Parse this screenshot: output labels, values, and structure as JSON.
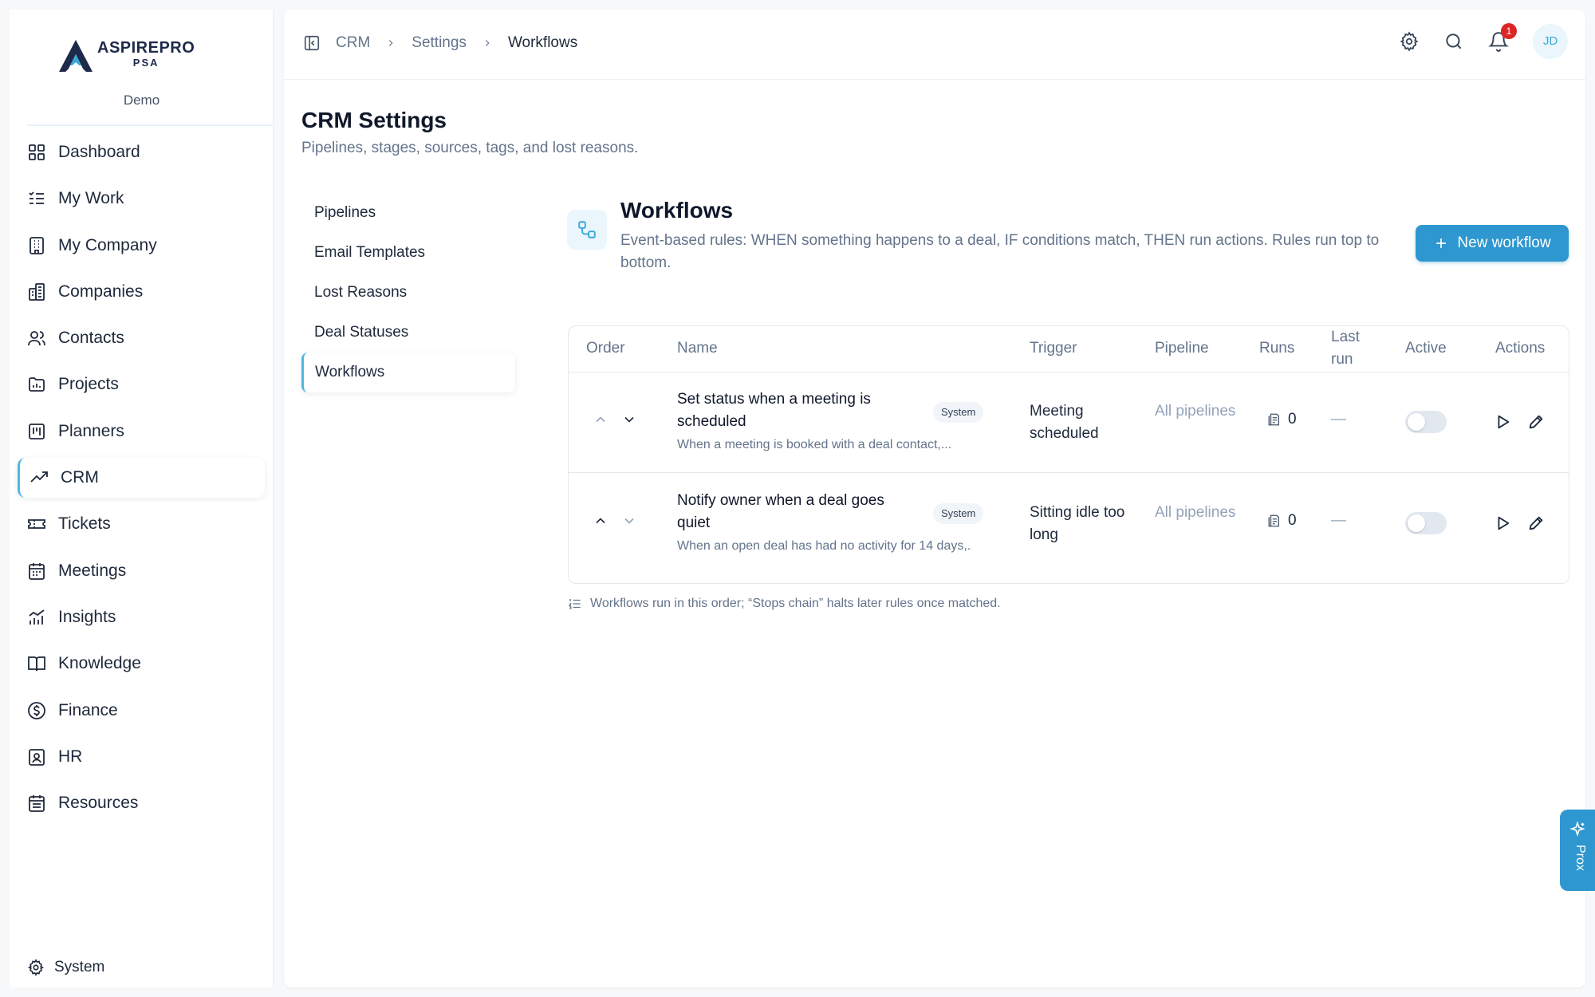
{
  "brand": {
    "name": "ASPIREPRO",
    "sub": "PSA",
    "org": "Demo"
  },
  "sidebar": {
    "items": [
      {
        "label": "Dashboard",
        "icon": "grid-icon"
      },
      {
        "label": "My Work",
        "icon": "checklist-icon"
      },
      {
        "label": "My Company",
        "icon": "building-icon"
      },
      {
        "label": "Companies",
        "icon": "buildings-icon"
      },
      {
        "label": "Contacts",
        "icon": "users-icon"
      },
      {
        "label": "Projects",
        "icon": "folder-chart-icon"
      },
      {
        "label": "Planners",
        "icon": "kanban-icon"
      },
      {
        "label": "CRM",
        "icon": "trending-up-icon",
        "active": true
      },
      {
        "label": "Tickets",
        "icon": "ticket-icon"
      },
      {
        "label": "Meetings",
        "icon": "calendar-icon"
      },
      {
        "label": "Insights",
        "icon": "bar-chart-icon"
      },
      {
        "label": "Knowledge",
        "icon": "book-icon"
      },
      {
        "label": "Finance",
        "icon": "dollar-icon"
      },
      {
        "label": "HR",
        "icon": "id-badge-icon"
      },
      {
        "label": "Resources",
        "icon": "calendar-grid-icon"
      }
    ],
    "system_label": "System"
  },
  "breadcrumb": {
    "items": [
      "CRM",
      "Settings",
      "Workflows"
    ]
  },
  "topbar": {
    "notification_count": "1",
    "avatar_initials": "JD"
  },
  "page": {
    "title": "CRM Settings",
    "subtitle": "Pipelines, stages, sources, tags, and lost reasons."
  },
  "settings_nav": {
    "items": [
      "Pipelines",
      "Email Templates",
      "Lost Reasons",
      "Deal Statuses",
      "Workflows"
    ],
    "active": "Workflows"
  },
  "workflows": {
    "title": "Workflows",
    "description": "Event-based rules: WHEN something happens to a deal, IF conditions match, THEN run actions. Rules run top to bottom.",
    "new_button": "New workflow",
    "columns": {
      "order": "Order",
      "name": "Name",
      "trigger": "Trigger",
      "pipeline": "Pipeline",
      "runs": "Runs",
      "last_run": "Last run",
      "active": "Active",
      "actions": "Actions"
    },
    "rows": [
      {
        "name": "Set status when a meeting is scheduled",
        "description": "When a meeting is booked with a deal contact,...",
        "badge": "System",
        "trigger": "Meeting scheduled",
        "pipeline": "All pipelines",
        "runs": "0",
        "last_run": "—",
        "active": false
      },
      {
        "name": "Notify owner when a deal goes quiet",
        "description": "When an open deal has had no activity for 14 days,...",
        "badge": "System",
        "trigger": "Sitting idle too long",
        "pipeline": "All pipelines",
        "runs": "0",
        "last_run": "—",
        "active": false
      }
    ],
    "footnote": "Workflows run in this order; “Stops chain” halts later rules once matched."
  },
  "assistant_tab": {
    "label": "Prox"
  },
  "colors": {
    "accent": "#2e97cf",
    "accent_light": "#4fb7e3",
    "badge_red": "#dc2626",
    "text": "#1e293b",
    "muted": "#64748b"
  }
}
